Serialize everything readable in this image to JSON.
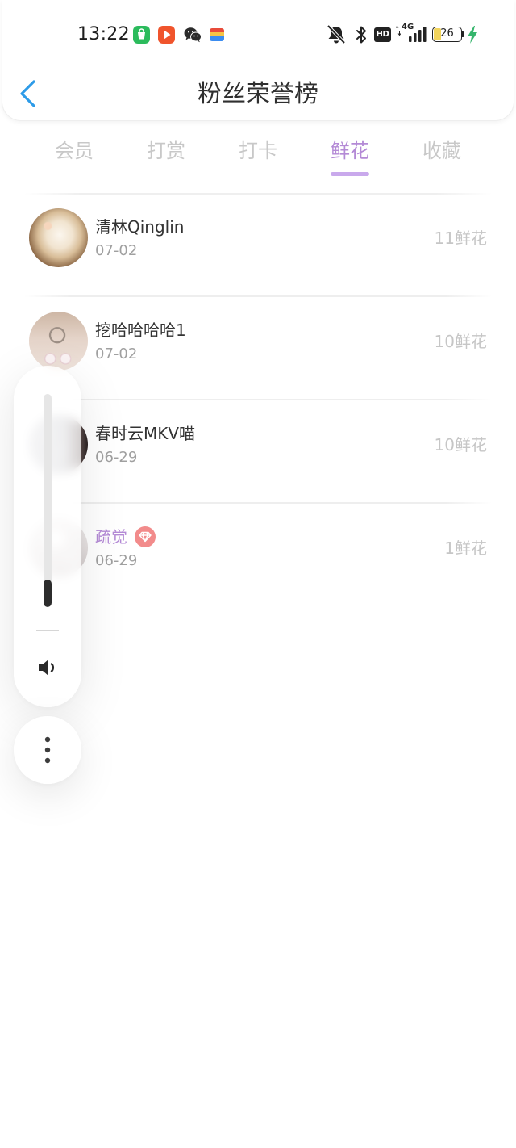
{
  "status_bar": {
    "time": "13:22",
    "notification_icons": [
      "app-store-icon",
      "video-play-icon",
      "wechat-icon",
      "wallet-icon"
    ],
    "mute_icon": "bell-off-icon",
    "bluetooth_icon": "bluetooth-icon",
    "hd_label": "HD",
    "network_label": "4G",
    "signal_icon": "signal-bars-icon",
    "battery_level": "26",
    "charging_icon": "charging-bolt-icon"
  },
  "header": {
    "back_icon": "chevron-left-icon",
    "title": "粉丝荣誉榜"
  },
  "tabs": [
    {
      "label": "会员",
      "active": false
    },
    {
      "label": "打赏",
      "active": false
    },
    {
      "label": "打卡",
      "active": false
    },
    {
      "label": "鲜花",
      "active": true
    },
    {
      "label": "收藏",
      "active": false
    }
  ],
  "list": [
    {
      "name": "清林Qinglin",
      "date": "07-02",
      "count": "11鲜花",
      "vip": false
    },
    {
      "name": "挖哈哈哈哈1",
      "date": "07-02",
      "count": "10鲜花",
      "vip": false
    },
    {
      "name": "春时云MKV喵",
      "date": "06-29",
      "count": "10鲜花",
      "vip": false
    },
    {
      "name": "疏觉",
      "date": "06-29",
      "count": "1鲜花",
      "vip": true,
      "badge_icon": "diamond-icon"
    }
  ],
  "volume_panel": {
    "level": 0.13,
    "speaker_icon": "speaker-icon",
    "more_icon": "more-vertical-icon"
  },
  "colors": {
    "accent": "#b48ad6",
    "tab_underline": "#c9a9ec",
    "back_button": "#2d9be8",
    "inactive_tab": "#c8c8c8",
    "vip_badge": "#f28b8b",
    "charging": "#35b56c",
    "name_text": "#333333",
    "date_text": "#a0a0a0",
    "count_text": "#c6c6c6"
  }
}
